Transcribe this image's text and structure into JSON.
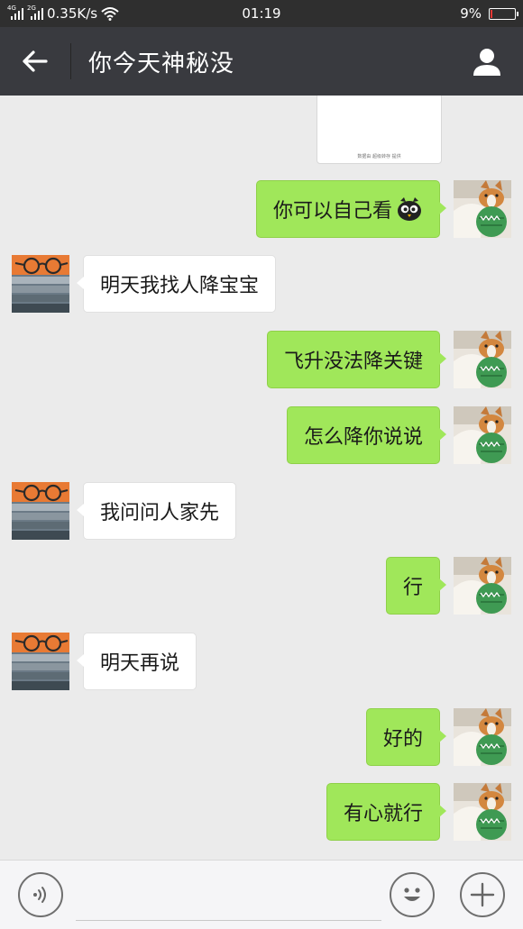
{
  "status_bar": {
    "network_4g": "4G",
    "network_2g": "2G",
    "speed": "0.35K/s",
    "time": "01:19",
    "battery_percent": "9%",
    "battery_level": 0.09,
    "battery_color": "#e53935"
  },
  "header": {
    "back_icon": "arrow-left-icon",
    "title": "你今天神秘没",
    "profile_icon": "person-icon"
  },
  "chat": {
    "file_card_caption": "数据由 超级转存 提供",
    "messages": [
      {
        "sender": "me",
        "text": "你可以自己看",
        "emoji": "owl-emoji-icon"
      },
      {
        "sender": "other",
        "text": "明天我找人降宝宝"
      },
      {
        "sender": "me",
        "text": "飞升没法降关键"
      },
      {
        "sender": "me",
        "text": "怎么降你说说"
      },
      {
        "sender": "other",
        "text": "我问问人家先"
      },
      {
        "sender": "me",
        "text": "行"
      },
      {
        "sender": "other",
        "text": "明天再说"
      },
      {
        "sender": "me",
        "text": "好的"
      },
      {
        "sender": "me",
        "text": "有心就行"
      }
    ],
    "colors": {
      "my_bubble": "#a0e75a",
      "their_bubble": "#ffffff",
      "background": "#ebebeb"
    }
  },
  "input_bar": {
    "voice_icon": "voice-icon",
    "text_value": "",
    "emoji_icon": "smiley-icon",
    "add_icon": "plus-icon"
  }
}
